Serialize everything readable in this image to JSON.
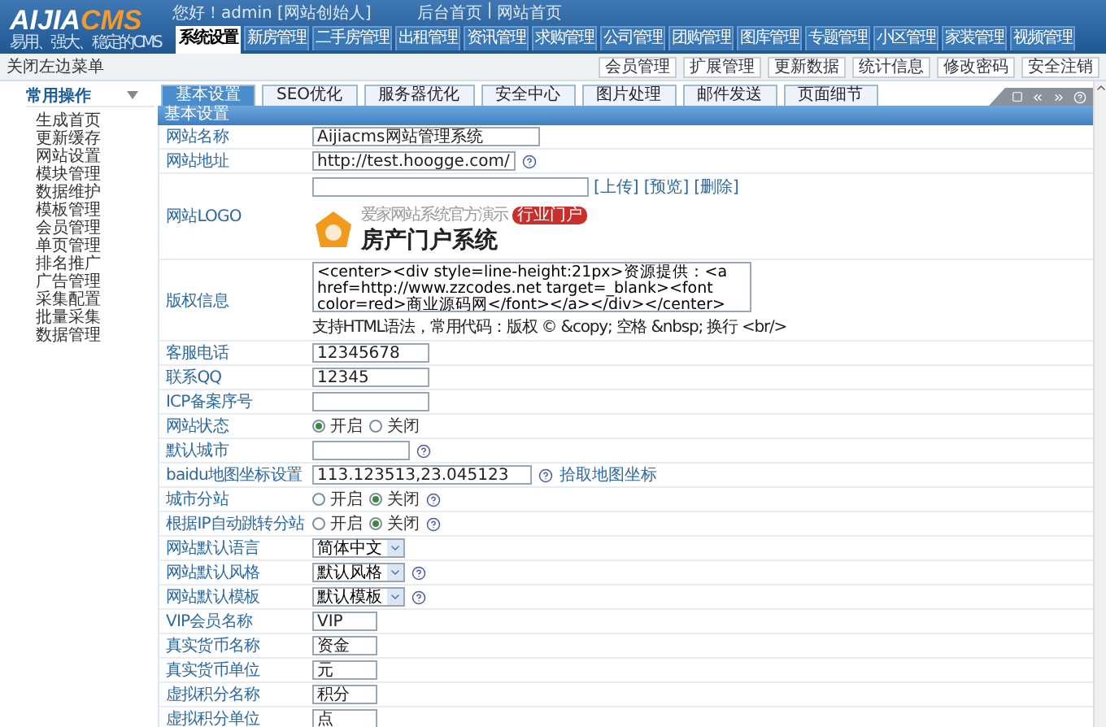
{
  "header": {
    "logo_main": "AIJIA",
    "logo_accent": "CMS",
    "tagline": "易用、强大、稳定的CMS",
    "greeting": "您好！admin [网站创始人]",
    "top_links": [
      "后台首页",
      "网站首页"
    ],
    "top_link_separator": "|",
    "nav_tabs": [
      {
        "label": "系统设置",
        "selected": true
      },
      {
        "label": "新房管理",
        "selected": false
      },
      {
        "label": "二手房管理",
        "selected": false
      },
      {
        "label": "出租管理",
        "selected": false
      },
      {
        "label": "资讯管理",
        "selected": false
      },
      {
        "label": "求购管理",
        "selected": false
      },
      {
        "label": "公司管理",
        "selected": false
      },
      {
        "label": "团购管理",
        "selected": false
      },
      {
        "label": "图库管理",
        "selected": false
      },
      {
        "label": "专题管理",
        "selected": false
      },
      {
        "label": "小区管理",
        "selected": false
      },
      {
        "label": "家装管理",
        "selected": false
      },
      {
        "label": "视频管理",
        "selected": false
      }
    ]
  },
  "sub_bar": {
    "toggle": "关闭左边菜单",
    "buttons": [
      "会员管理",
      "扩展管理",
      "更新数据",
      "统计信息",
      "修改密码",
      "安全注销"
    ]
  },
  "sidebar": {
    "title": "常用操作",
    "items": [
      "生成首页",
      "更新缓存",
      "网站设置",
      "模块管理",
      "数据维护",
      "模板管理",
      "会员管理",
      "单页管理",
      "排名推广",
      "广告管理",
      "采集配置",
      "批量采集",
      "数据管理"
    ]
  },
  "tabs": [
    {
      "label": "基本设置",
      "selected": true
    },
    {
      "label": "SEO优化",
      "selected": false
    },
    {
      "label": "服务器优化",
      "selected": false
    },
    {
      "label": "安全中心",
      "selected": false
    },
    {
      "label": "图片处理",
      "selected": false
    },
    {
      "label": "邮件发送",
      "selected": false
    },
    {
      "label": "页面细节",
      "selected": false
    }
  ],
  "section_title": "基本设置",
  "rows": [
    {
      "kind": "text",
      "label": "网站名称",
      "value": "Aijiacms网站管理系统",
      "help": false
    },
    {
      "kind": "text",
      "label": "网站地址",
      "value": "http://test.hoogge.com/",
      "help": true
    },
    {
      "kind": "logo",
      "label": "网站LOGO",
      "links": [
        "[上传]",
        "[预览]",
        "[删除]"
      ],
      "logo_preview": {
        "tagline": "爱家网站系统官方演示",
        "badge": "行业门户",
        "title": "房产门户系统"
      }
    },
    {
      "kind": "textarea",
      "label": "版权信息",
      "value": "<center><div style=line-height:21px>资源提供：<a href=http://www.zzcodes.net target=_blank><font color=red>商业源码网</font></a></div></center>",
      "note": "支持HTML语法，常用代码：版权 © &copy; 空格 &nbsp; 换行 <br/>"
    },
    {
      "kind": "text",
      "label": "客服电话",
      "value": "12345678",
      "help": false
    },
    {
      "kind": "text",
      "label": "联系QQ",
      "value": "12345",
      "help": false
    },
    {
      "kind": "text",
      "label": "ICP备案序号",
      "value": "",
      "help": false
    },
    {
      "kind": "radio",
      "label": "网站状态",
      "options": [
        {
          "label": "开启",
          "selected": true
        },
        {
          "label": "关闭",
          "selected": false
        }
      ],
      "help": false
    },
    {
      "kind": "text",
      "label": "默认城市",
      "value": "",
      "help": true
    },
    {
      "kind": "text",
      "label": "baidu地图坐标设置",
      "value": "113.123513,23.045123",
      "help": true,
      "link": "拾取地图坐标"
    },
    {
      "kind": "radio",
      "label": "城市分站",
      "options": [
        {
          "label": "开启",
          "selected": false
        },
        {
          "label": "关闭",
          "selected": true
        }
      ],
      "help": true
    },
    {
      "kind": "radio",
      "label": "根据IP自动跳转分站",
      "options": [
        {
          "label": "开启",
          "selected": false
        },
        {
          "label": "关闭",
          "selected": true
        }
      ],
      "help": true
    },
    {
      "kind": "select",
      "label": "网站默认语言",
      "value": "简体中文",
      "help": false
    },
    {
      "kind": "select",
      "label": "网站默认风格",
      "value": "默认风格",
      "help": true
    },
    {
      "kind": "select",
      "label": "网站默认模板",
      "value": "默认模板",
      "help": true
    },
    {
      "kind": "text",
      "label": "VIP会员名称",
      "value": "VIP",
      "help": false
    },
    {
      "kind": "text",
      "label": "真实货币名称",
      "value": "资金",
      "help": false
    },
    {
      "kind": "text",
      "label": "真实货币单位",
      "value": "元",
      "help": false
    },
    {
      "kind": "text",
      "label": "虚拟积分名称",
      "value": "积分",
      "help": false
    },
    {
      "kind": "text",
      "label": "虚拟积分单位",
      "value": "点",
      "help": false
    }
  ]
}
